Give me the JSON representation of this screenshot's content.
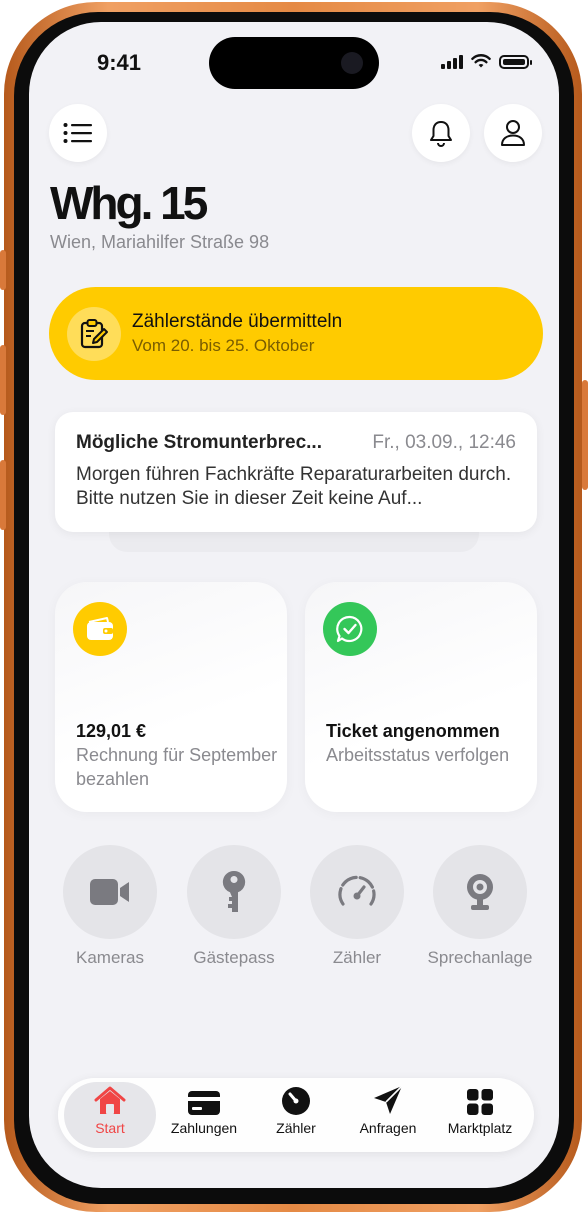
{
  "status_bar": {
    "time": "9:41"
  },
  "header": {
    "menu_icon": "list-icon",
    "notification_icon": "bell-icon",
    "profile_icon": "person-icon",
    "title": "Whg. 15",
    "address": "Wien, Mariahilfer Straße 98"
  },
  "banner": {
    "icon": "clipboard-edit-icon",
    "title": "Zählerstände übermitteln",
    "subtitle": "Vom 20. bis 25. Oktober",
    "color": "#FFCB00"
  },
  "notification": {
    "title": "Mögliche Stromunterbrec...",
    "time": "Fr., 03.09., 12:46",
    "body": "Morgen führen Fachkräfte Reparaturarbeiten durch. Bitte nutzen Sie in dieser Zeit keine Auf..."
  },
  "cards": [
    {
      "icon": "wallet-icon",
      "icon_color": "#FFCB00",
      "title": "129,01 €",
      "subtitle": "Rechnung für September bezahlen"
    },
    {
      "icon": "chat-check-icon",
      "icon_color": "#34C759",
      "title": "Ticket angenommen",
      "subtitle": "Arbeitsstatus verfolgen"
    }
  ],
  "quick_actions": [
    {
      "icon": "video-camera-icon",
      "label": "Kameras"
    },
    {
      "icon": "key-icon",
      "label": "Gästepass"
    },
    {
      "icon": "gauge-icon",
      "label": "Zähler"
    },
    {
      "icon": "webcam-icon",
      "label": "Sprechanlage"
    }
  ],
  "tab_bar": {
    "active": "Start",
    "accent_color": "#F04545",
    "tabs": [
      {
        "icon": "house-icon",
        "label": "Start"
      },
      {
        "icon": "card-icon",
        "label": "Zahlungen"
      },
      {
        "icon": "meter-icon",
        "label": "Zähler"
      },
      {
        "icon": "paper-plane-icon",
        "label": "Anfragen"
      },
      {
        "icon": "grid-icon",
        "label": "Marktplatz"
      }
    ]
  }
}
